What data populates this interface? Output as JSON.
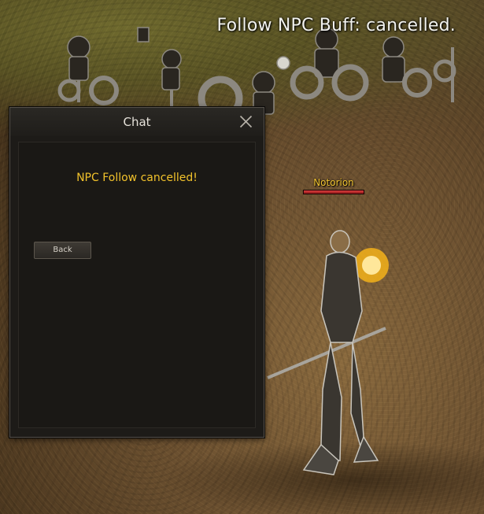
{
  "system_notice": "Follow NPC Buff: cancelled.",
  "player": {
    "name": "Notorion",
    "hp_fraction": 1.0
  },
  "chat_window": {
    "title": "Chat",
    "close_icon": "close-icon",
    "message": "NPC Follow cancelled!",
    "back_button_label": "Back"
  },
  "colors": {
    "notice_text": "#f2f2ee",
    "player_name": "#f0c330",
    "chat_message": "#f2c22b",
    "hp_bar": "#e04040"
  }
}
